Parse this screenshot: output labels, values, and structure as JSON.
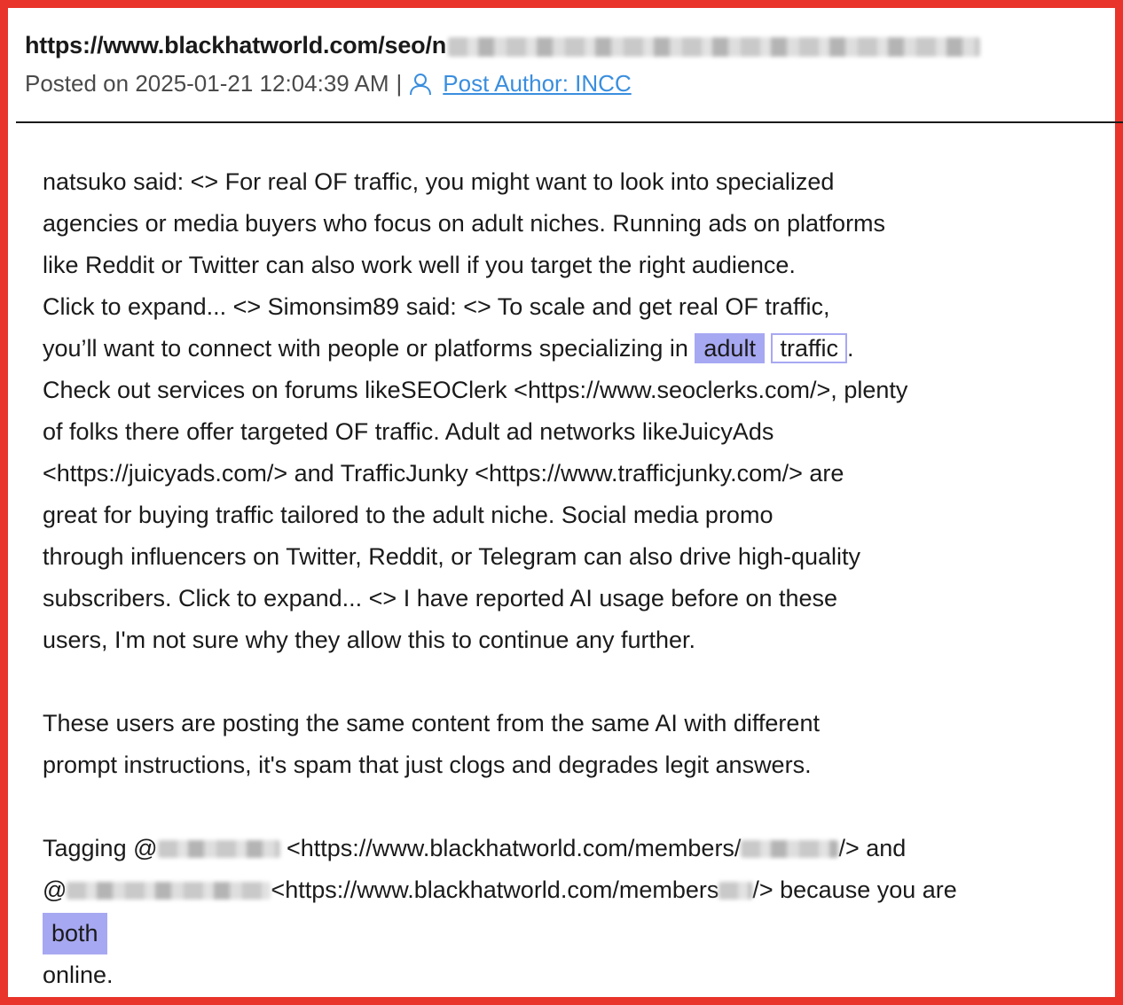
{
  "header": {
    "url_prefix": "https://www.blackhatworld.com/seo/n",
    "posted_label": "Posted on 2025-01-21 12:04:39 AM",
    "separator": "|",
    "author_link": "Post Author: INCC"
  },
  "post": {
    "line1": "natsuko said: <>  For real OF traffic, you might want to look into specialized",
    "line2": "agencies or media buyers who focus on adult niches. Running ads on platforms",
    "line3": "like Reddit or Twitter can also work well if you target the right audience.",
    "line4": "Click to expand... <> Simonsim89 said: <>  To scale and get real OF traffic,",
    "line5_before": "you’ll want to connect with people or platforms specializing in ",
    "line5_hl1": "adult",
    "line5_hl2": "traffic",
    "line5_after": ".",
    "line6": "Check out services on forums likeSEOClerk <https://www.seoclerks.com/>, plenty",
    "line7": "of folks there offer targeted OF traffic. Adult ad networks likeJuicyAds",
    "line8": "<https://juicyads.com/> and TrafficJunky <https://www.trafficjunky.com/> are",
    "line9": "great for buying traffic tailored to the adult niche. Social media promo",
    "line10": "through influencers on Twitter, Reddit, or Telegram can also drive high-quality",
    "line11": "subscribers. Click to expand... <> I have reported AI usage before on these",
    "line12": "users, I'm not sure why they allow this to continue any further.",
    "line13": " These users are posting the same content from the same AI with different",
    "line14": "prompt instructions, it's spam that just clogs and degrades legit answers.",
    "line15_a": " Tagging @",
    "line15_b": " <https://www.blackhatworld.com/members/",
    "line15_c": "/> and",
    "line16_a": "@",
    "line16_b": "<https://www.blackhatworld.com/members",
    "line16_c": "/> because you are",
    "line17_hl": "both",
    "line18": "online."
  },
  "colors": {
    "frame": "#e8342a",
    "highlight": "#a7a8f2",
    "link": "#3a8ede"
  },
  "icons": {
    "author": "user-icon"
  }
}
